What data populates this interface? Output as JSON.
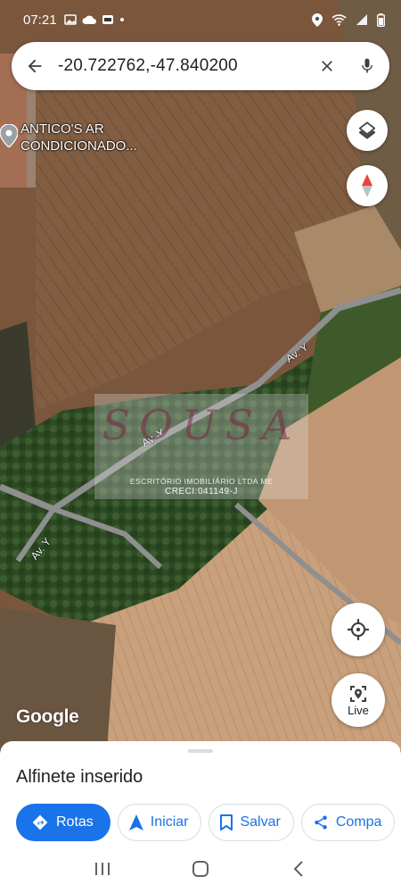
{
  "status_bar": {
    "time": "07:21",
    "left_icons": [
      "image-icon",
      "cloud-icon",
      "app-icon",
      "dot-icon"
    ],
    "right_icons": [
      "location-icon",
      "wifi-icon",
      "signal-icon",
      "battery-icon"
    ]
  },
  "search": {
    "query": "-20.722762,-47.840200"
  },
  "map": {
    "poi_label": "ANTICO'S AR\nCONDICIONADO...",
    "road_labels": [
      "Av. Y",
      "Av. Y",
      "Av. Y"
    ],
    "attribution": "Google"
  },
  "watermark": {
    "brand": "SOUSA",
    "subtitle": "ESCRITÓRIO IMOBILIÁRIO LTDA ME",
    "creci": "CRECI:041149-J"
  },
  "map_buttons": {
    "live_label": "Live"
  },
  "sheet": {
    "title": "Alfinete inserido",
    "actions": [
      {
        "label": "Rotas",
        "icon": "directions-icon",
        "primary": true
      },
      {
        "label": "Iniciar",
        "icon": "navigation-icon",
        "primary": false
      },
      {
        "label": "Salvar",
        "icon": "bookmark-icon",
        "primary": false
      },
      {
        "label": "Compa",
        "icon": "share-icon",
        "primary": false
      }
    ]
  },
  "colors": {
    "accent": "#1a73e8",
    "field": "#8a6446",
    "field_light": "#c9a27c",
    "vegetation": "#2f4d25"
  }
}
